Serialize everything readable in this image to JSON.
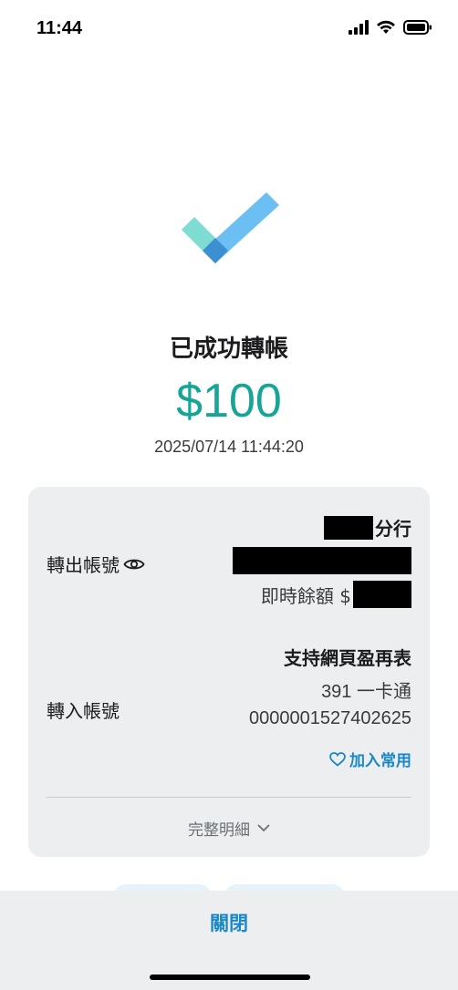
{
  "status_bar": {
    "time": "11:44"
  },
  "result": {
    "title": "已成功轉帳",
    "amount": "$100",
    "datetime": "2025/07/14 11:44:20"
  },
  "from_account": {
    "label": "轉出帳號",
    "branch_suffix": "分行",
    "balance_label": "即時餘額 $"
  },
  "to_account": {
    "label": "轉入帳號",
    "name": "支持網頁盈再表",
    "bank": "391 一卡通",
    "number": "0000001527402625",
    "add_favorite": "加入常用"
  },
  "details_toggle": "完整明細",
  "bottom": {
    "close_label": "關閉"
  },
  "colors": {
    "amount": "#16a596",
    "accent": "#1a88c7",
    "card_bg": "#eceeef"
  }
}
